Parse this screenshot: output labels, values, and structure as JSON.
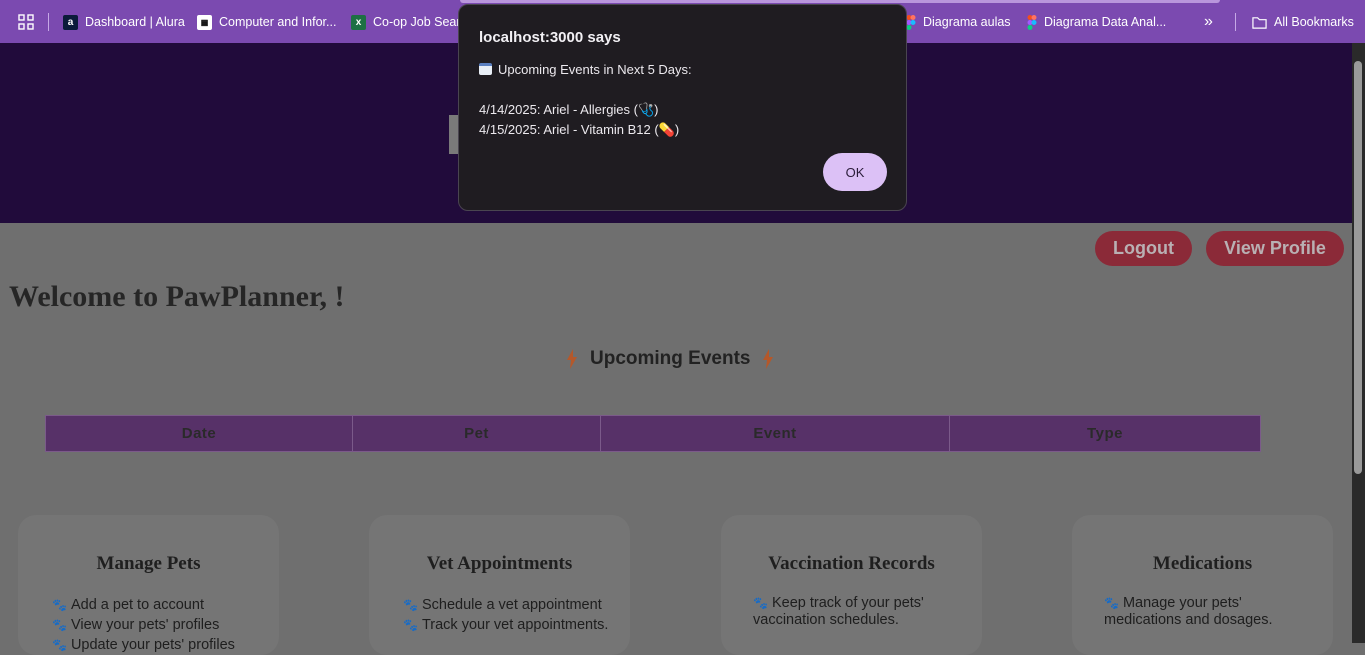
{
  "bookmarks": {
    "items": [
      {
        "label": "Dashboard | Alura",
        "icon": "alura-icon"
      },
      {
        "label": "Computer and Infor...",
        "icon": "qr-icon"
      },
      {
        "label": "Co-op Job Searc",
        "icon": "excel-icon"
      },
      {
        "label": "Diagrama aulas",
        "icon": "figma-icon"
      },
      {
        "label": "Diagrama Data Anal...",
        "icon": "figma-icon"
      }
    ],
    "overflow": "»",
    "all_bookmarks": "All Bookmarks"
  },
  "page": {
    "logout": "Logout",
    "view_profile": "View Profile",
    "welcome": "Welcome to PawPlanner, !",
    "events_title": "Upcoming Events",
    "table_headers": [
      "Date",
      "Pet",
      "Event",
      "Type"
    ],
    "cards": [
      {
        "title": "Manage Pets",
        "items": [
          "Add a pet to account",
          "View your pets' profiles",
          "Update your pets' profiles"
        ]
      },
      {
        "title": "Vet Appointments",
        "items": [
          "Schedule a vet appointment",
          "Track your vet appointments."
        ]
      },
      {
        "title": "Vaccination Records",
        "text": "Keep track of your pets' vaccination schedules."
      },
      {
        "title": "Medications",
        "text": "Manage your pets' medications and dosages."
      }
    ]
  },
  "dialog": {
    "title": "localhost:3000 says",
    "heading": "Upcoming Events in Next 5 Days:",
    "lines": [
      "4/14/2025: Ariel - Allergies (🩺)",
      "4/15/2025: Ariel - Vitamin B12 (💊)"
    ],
    "ok": "OK"
  },
  "colors": {
    "bookmark_bar": "#7b4ab0",
    "header": "#210b3b",
    "button": "#8b2a38",
    "table_header": "#573168",
    "dialog_bg": "#1f1c21",
    "ok_button": "#dcc1f6"
  }
}
